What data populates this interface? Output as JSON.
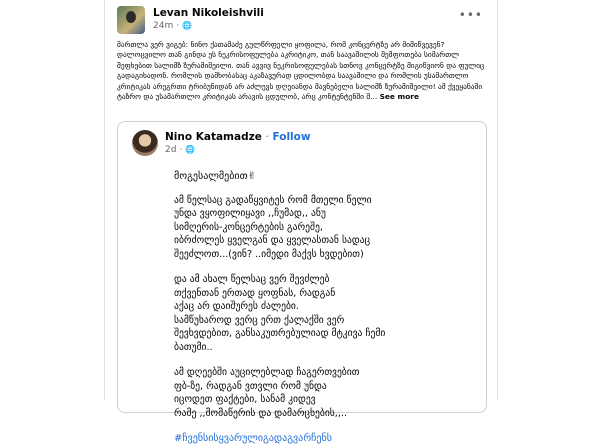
{
  "post": {
    "author": "Levan Nikoleishvili",
    "time": "24m",
    "privacy_icon": "globe-icon",
    "more_icon": "more-dots-icon",
    "text": "მართლა ვერ ვიგებ: ნინო ქათამაძე გულწრფელი ყოფილა, რომ კონცერტზე არ მიმიწვევენ? დალოცვილო თან გინდა ეს ნეკრისოფულება აკრიტიკო, თან საავაშილის შეშფოთება სიმართლ შეფხებით სალიმზ ზურამიშეილი. თან ავვივ ნეკრისოფულებას სთნოვ კონცერტზე მიგიწვიონ  და ფულიც გადაგიხადონ. რომლის დამხობასაც აკაზავურად ცდილობდა საავაშილი  და რომლის უსამართლო კრიტიკას არეგრთი ტრიბუნიდან არ აძლევს დღეიანდა მავნებელი სალიმზ ზურამიშეილი! ამ ქვეყანაში ტაზრო და უსამართლო კრიტიკას არავის ცდულობ,  არც კონტენტენში შ...",
    "see_more": "See more"
  },
  "shared": {
    "author": "Nino Katamadze",
    "separator": "·",
    "follow": "Follow",
    "time": "2d",
    "privacy_icon": "globe-icon",
    "greeting": "მოგესალმებით✌",
    "paragraphs": [
      "ამ წელსაც გადაწყვიტეს რომ მთელი წელი\nუნდა ვყოფილიყავი ,,ჩუმად,, ანუ\nსიმღერის-კონცერტების გარეშე,\nიბრძოლეს ყველგან და ყველასთან სადაც\nშეეძლოთ...(ვინ? ..იმედი მაქვს ხვდებით)",
      "და ამ ახალ წელსაც ვერ შევძლებ\nთქვენთან ერთად ყოფნას, რადგან\nაქაც არ დაიშურეს ძალები.\nსამწუხაროდ ვერც ერთ ქალაქში ვერ\nშევხვდებით, განსაკუთრებულიად მტკივა ჩემი\nბათუმი..",
      "ამ დღეებში აუცილებლად ჩაგერთვებით\nფბ-ზე, რადგან ვთვლი რომ უნდა\nიცოდეთ ფაქტები, სანამ კიდევ\nრამე ,,მომაწერის და დამარცხების,,.."
    ],
    "hashtag": "#ჩვენსისყვარულიგადაგვარჩენს"
  }
}
